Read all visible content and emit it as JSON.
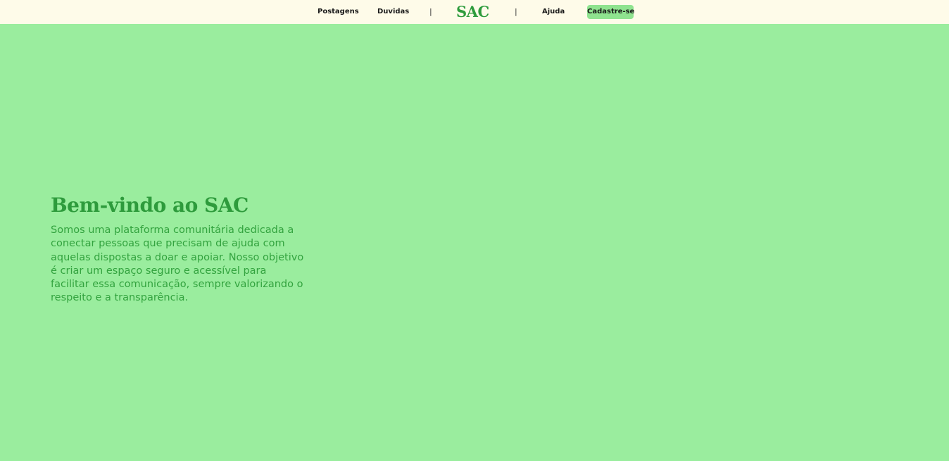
{
  "nav": {
    "posts": "Postagens",
    "questions": "Duvidas",
    "separator_left": "|",
    "logo": "SAC",
    "separator_right": "|",
    "help": "Ajuda",
    "signup": "Cadastre-se"
  },
  "hero": {
    "title": "Bem-vindo ao SAC",
    "description": "Somos uma plataforma comunitária dedicada a conectar pessoas que precisam de ajuda com aquelas dispostas a doar e apoiar. Nosso objetivo é criar um espaço seguro e acessível para facilitar essa comunicação, sempre valorizando o respeito e a transparência."
  },
  "colors": {
    "page_background": "#9aed9e",
    "header_background": "#fefbe9",
    "brand_green": "#2e9b3c",
    "signup_button": "#8fe38f"
  }
}
